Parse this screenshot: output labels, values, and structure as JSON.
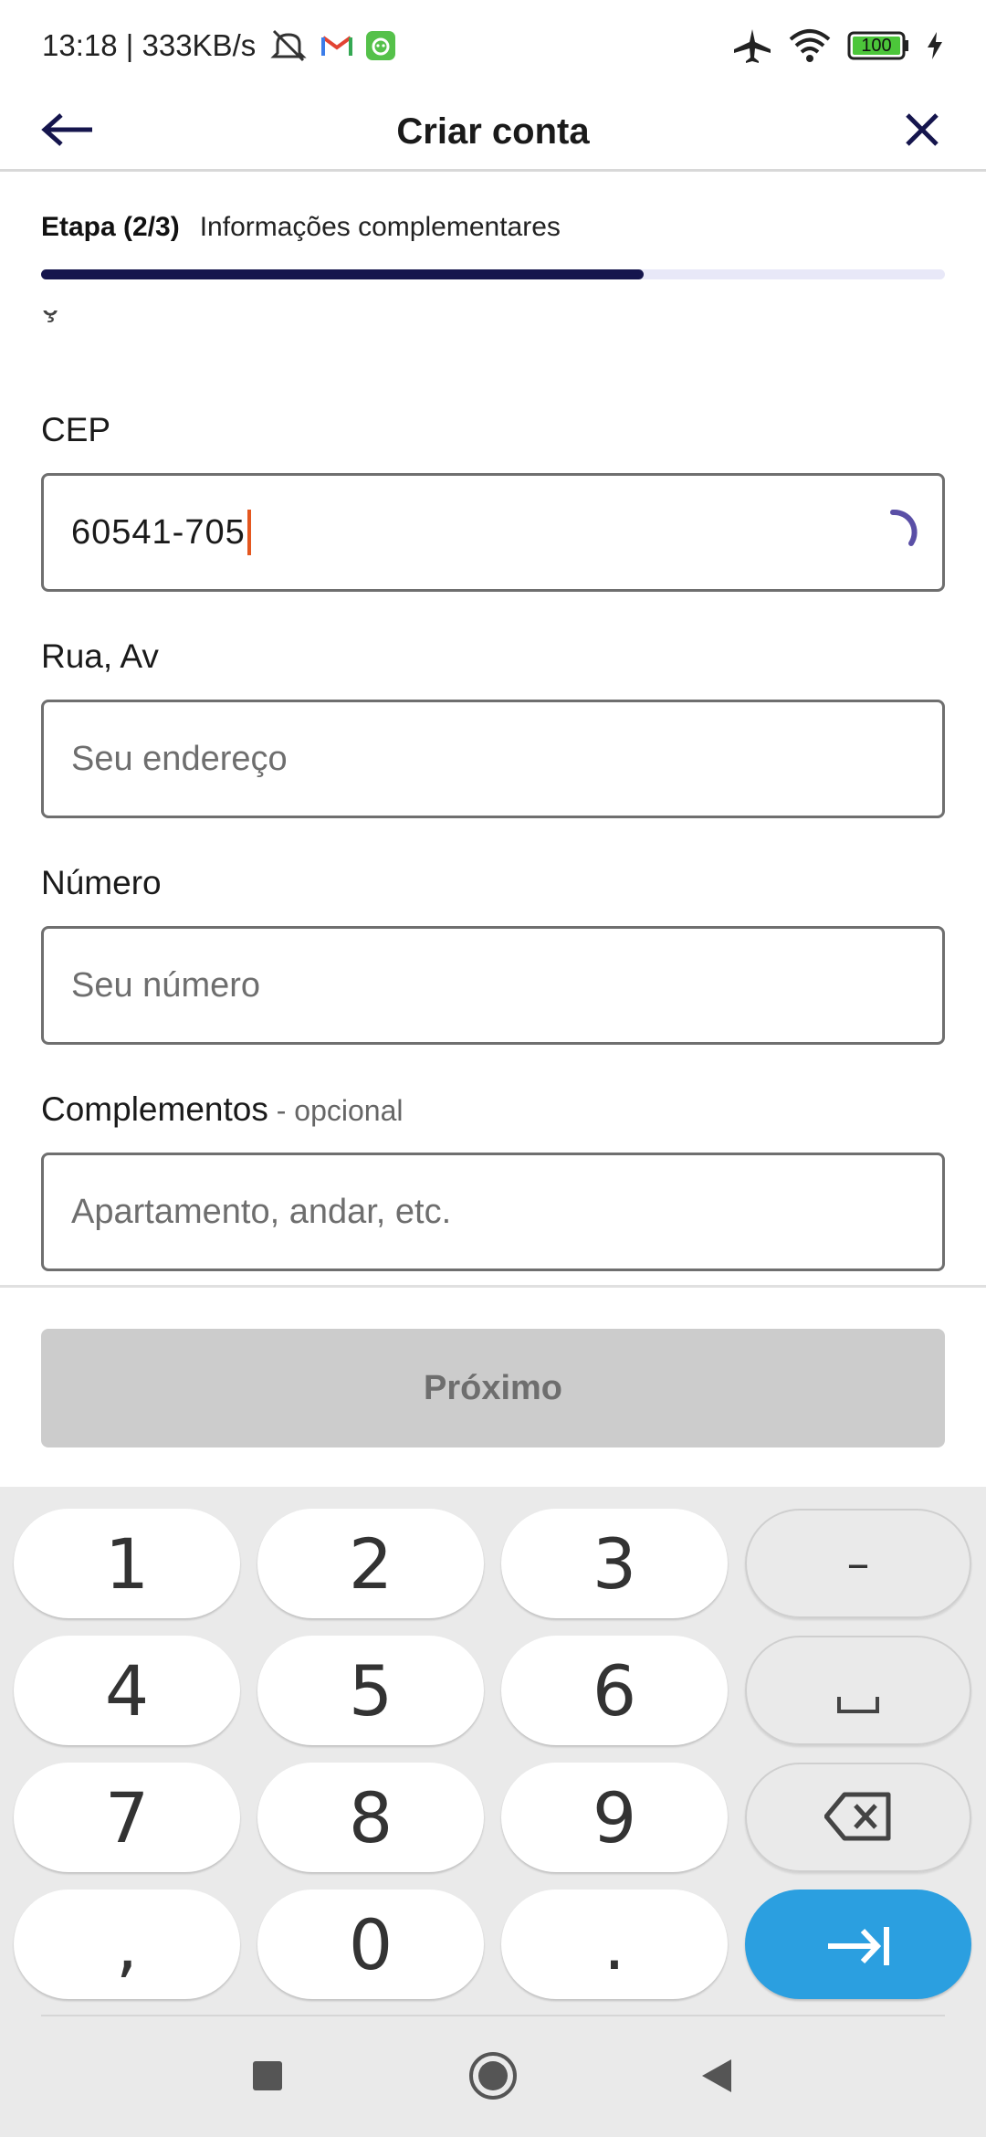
{
  "status_bar": {
    "time_network": "13:18 | 333KB/s",
    "battery": "100",
    "icons": [
      "mute-icon",
      "gmail-icon",
      "app-icon",
      "airplane-icon",
      "wifi-icon",
      "battery-icon",
      "charging-icon"
    ]
  },
  "header": {
    "title": "Criar conta",
    "back_icon": "arrow-left-icon",
    "close_icon": "close-icon"
  },
  "step": {
    "label": "Etapa (2/3)",
    "description": "Informações complementares",
    "progress_fraction": 0.667,
    "colors": {
      "fill": "#15154d",
      "track": "#e8e8f8"
    }
  },
  "form": {
    "cep": {
      "label": "CEP",
      "value": "60541-705"
    },
    "street": {
      "label": "Rua, Av",
      "placeholder": "Seu endereço"
    },
    "number": {
      "label": "Número",
      "placeholder": "Seu número"
    },
    "complement": {
      "label": "Complementos",
      "optional": " - opcional",
      "placeholder": "Apartamento, andar, etc."
    }
  },
  "footer": {
    "next_label": "Próximo"
  },
  "keyboard": {
    "keys": [
      "1",
      "2",
      "3",
      "–",
      "4",
      "5",
      "6",
      "␣",
      "7",
      "8",
      "9",
      "⌫",
      ",",
      "0",
      ".",
      "⇥"
    ],
    "enter_color": "#2b9fe0"
  },
  "nav": {
    "icons": [
      "recent-apps-icon",
      "home-icon",
      "back-icon"
    ]
  }
}
